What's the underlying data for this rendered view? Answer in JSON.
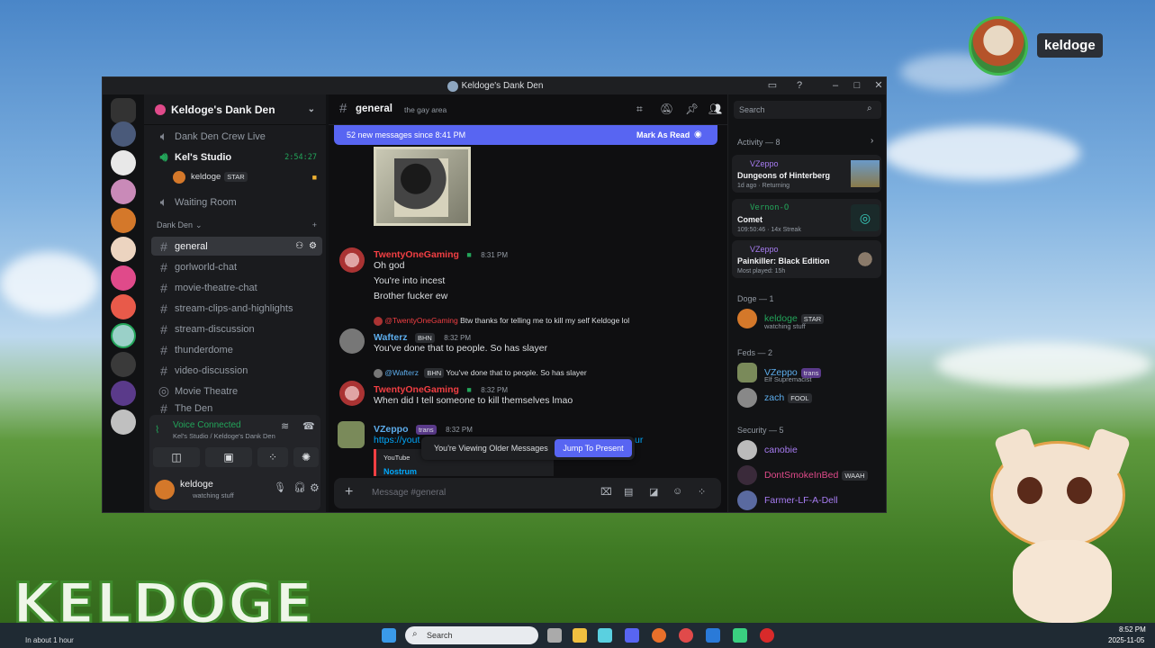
{
  "window": {
    "title": "Keldoge's Dank Den"
  },
  "server": {
    "name": "Keldoge's Dank Den"
  },
  "voice_channels": [
    {
      "name": "Dank Den Crew Live"
    },
    {
      "name": "Kel's Studio",
      "timer": "2:54:27"
    },
    {
      "name": "Waiting Room"
    }
  ],
  "voice_user": {
    "name": "keldoge",
    "badge": "STAR"
  },
  "category": {
    "name": "Dank Den"
  },
  "channels": [
    "general",
    "gorlworld-chat",
    "movie-theatre-chat",
    "stream-clips-and-highlights",
    "stream-discussion",
    "thunderdome",
    "video-discussion",
    "Movie Theatre",
    "The Den"
  ],
  "voice_panel": {
    "status": "Voice Connected",
    "location": "Kel's Studio / Keldoge's Dank Den"
  },
  "user_panel": {
    "name": "keldoge",
    "status": "watching stuff"
  },
  "channel_header": {
    "name": "general",
    "topic": "the gay area",
    "search_placeholder": "Search"
  },
  "banner": {
    "text": "52 new messages since 8:41 PM",
    "action": "Mark As Read"
  },
  "messages": [
    {
      "author": "TwentyOneGaming",
      "time": "8:31 PM",
      "lines": [
        "Oh god",
        "You're into incest",
        "Brother fucker ew"
      ]
    },
    {
      "reply_to": "@TwentyOneGaming",
      "reply_text": "Btw thanks for telling me to kill my self Keldoge lol",
      "author": "Wafterz",
      "tag": "BHN",
      "time": "8:32 PM",
      "lines": [
        "You've done that to people. So has slayer"
      ]
    },
    {
      "reply_to": "@Wafterz",
      "reply_tag": "BHN",
      "reply_text": "You've done that to people. So has slayer",
      "author": "TwentyOneGaming",
      "time": "8:32 PM",
      "lines": [
        "When did I tell someone to kill themselves lmao"
      ]
    },
    {
      "author": "VZeppo",
      "tag": "trans",
      "time": "8:32 PM",
      "link": "https://yout",
      "link_tail": "ur",
      "embed_provider": "YouTube",
      "embed_title": "Nostrum"
    }
  ],
  "older_bar": {
    "text": "You're Viewing Older Messages",
    "button": "Jump To Present"
  },
  "composer": {
    "placeholder": "Message #general"
  },
  "activity": {
    "header": "Activity — 8",
    "items": [
      {
        "user": "VZeppo",
        "game": "Dungeons of Hinterberg",
        "meta": "1d ago · Returning"
      },
      {
        "user": "Vernon-O",
        "game": "Comet",
        "meta": "109:50:46 · 14x Streak"
      },
      {
        "user": "VZeppo",
        "game": "Painkiller: Black Edition",
        "meta": "Most played: 15h"
      }
    ]
  },
  "members": {
    "doge": {
      "header": "Doge — 1",
      "items": [
        {
          "name": "keldoge",
          "badge": "STAR",
          "status": "watching stuff"
        }
      ]
    },
    "feds": {
      "header": "Feds — 2",
      "items": [
        {
          "name": "VZeppo",
          "badge": "trans",
          "status": "Elf Supremacist"
        },
        {
          "name": "zach",
          "badge": "FOOL"
        }
      ]
    },
    "security": {
      "header": "Security — 5",
      "items": [
        {
          "name": "canobie"
        },
        {
          "name": "DontSmokeInBed",
          "badge": "WAAH"
        },
        {
          "name": "Farmer-LF-A-Dell"
        }
      ]
    }
  },
  "overlay": {
    "streamer": "keldoge",
    "logo_text": "KELDOGE"
  },
  "taskbar": {
    "weather": "In about 1 hour",
    "search": "Search",
    "time": "8:52 PM",
    "date": "2025-11-05"
  },
  "colors": {
    "accent": "#5865f2",
    "online": "#23a55a",
    "red_name": "#f23f43",
    "blue_name": "#5dadec",
    "purple_name": "#a77cf2"
  }
}
